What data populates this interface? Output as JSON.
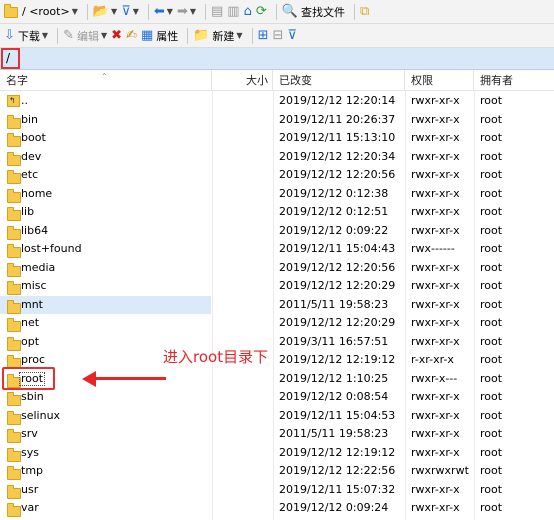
{
  "toolbar1": {
    "path_label": "/ <root>",
    "find_files_label": "查找文件"
  },
  "toolbar2": {
    "download_label": "下载",
    "edit_label": "编辑",
    "properties_label": "属性",
    "new_label": "新建"
  },
  "path_bar": {
    "path": "/"
  },
  "columns": {
    "name": "名字",
    "size": "大小",
    "modified": "已改变",
    "rights": "权限",
    "owner": "拥有者"
  },
  "files": [
    {
      "name": "..",
      "modified": "2019/12/12 12:20:14",
      "rights": "rwxr-xr-x",
      "owner": "root",
      "parent": true
    },
    {
      "name": "bin",
      "modified": "2019/12/11 20:26:37",
      "rights": "rwxr-xr-x",
      "owner": "root"
    },
    {
      "name": "boot",
      "modified": "2019/12/11 15:13:10",
      "rights": "rwxr-xr-x",
      "owner": "root"
    },
    {
      "name": "dev",
      "modified": "2019/12/12 12:20:34",
      "rights": "rwxr-xr-x",
      "owner": "root"
    },
    {
      "name": "etc",
      "modified": "2019/12/12 12:20:56",
      "rights": "rwxr-xr-x",
      "owner": "root"
    },
    {
      "name": "home",
      "modified": "2019/12/12 0:12:38",
      "rights": "rwxr-xr-x",
      "owner": "root"
    },
    {
      "name": "lib",
      "modified": "2019/12/12 0:12:51",
      "rights": "rwxr-xr-x",
      "owner": "root"
    },
    {
      "name": "lib64",
      "modified": "2019/12/12 0:09:22",
      "rights": "rwxr-xr-x",
      "owner": "root"
    },
    {
      "name": "lost+found",
      "modified": "2019/12/11 15:04:43",
      "rights": "rwx------",
      "owner": "root"
    },
    {
      "name": "media",
      "modified": "2019/12/12 12:20:56",
      "rights": "rwxr-xr-x",
      "owner": "root"
    },
    {
      "name": "misc",
      "modified": "2019/12/12 12:20:29",
      "rights": "rwxr-xr-x",
      "owner": "root"
    },
    {
      "name": "mnt",
      "modified": "2011/5/11 19:58:23",
      "rights": "rwxr-xr-x",
      "owner": "root",
      "hover": true
    },
    {
      "name": "net",
      "modified": "2019/12/12 12:20:29",
      "rights": "rwxr-xr-x",
      "owner": "root"
    },
    {
      "name": "opt",
      "modified": "2019/3/11 16:57:51",
      "rights": "rwxr-xr-x",
      "owner": "root"
    },
    {
      "name": "proc",
      "modified": "2019/12/12 12:19:12",
      "rights": "r-xr-xr-x",
      "owner": "root"
    },
    {
      "name": "root",
      "modified": "2019/12/12 1:10:25",
      "rights": "rwxr-x---",
      "owner": "root"
    },
    {
      "name": "sbin",
      "modified": "2019/12/12 0:08:54",
      "rights": "rwxr-xr-x",
      "owner": "root"
    },
    {
      "name": "selinux",
      "modified": "2019/12/11 15:04:53",
      "rights": "rwxr-xr-x",
      "owner": "root"
    },
    {
      "name": "srv",
      "modified": "2011/5/11 19:58:23",
      "rights": "rwxr-xr-x",
      "owner": "root"
    },
    {
      "name": "sys",
      "modified": "2019/12/12 12:19:12",
      "rights": "rwxr-xr-x",
      "owner": "root"
    },
    {
      "name": "tmp",
      "modified": "2019/12/12 12:22:56",
      "rights": "rwxrwxrwt",
      "owner": "root"
    },
    {
      "name": "usr",
      "modified": "2019/12/11 15:07:32",
      "rights": "rwxr-xr-x",
      "owner": "root"
    },
    {
      "name": "var",
      "modified": "2019/12/12 0:09:24",
      "rights": "rwxr-xr-x",
      "owner": "root"
    }
  ],
  "annotation": {
    "text": "进入root目录下"
  },
  "colors": {
    "highlight_red": "#e53131",
    "path_bar": "#d9e8f8",
    "hover_row": "#dbeaf9"
  }
}
